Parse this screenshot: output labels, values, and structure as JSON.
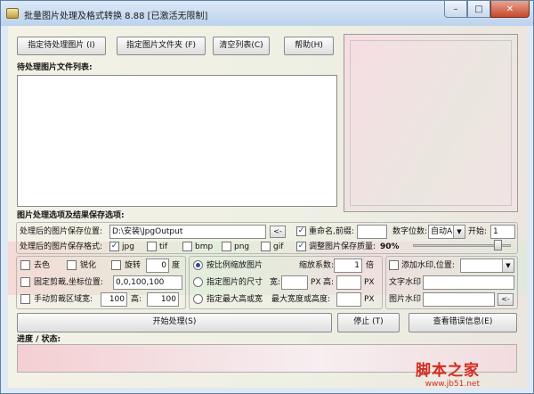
{
  "window": {
    "title": "批量图片处理及格式转换 8.88 [已激活无限制]",
    "min": "–",
    "max": "□",
    "close": "✕"
  },
  "toolbar": {
    "select_images": "指定待处理图片 (I)",
    "select_folder": "指定图片文件夹 (F)",
    "clear_list": "清空列表(C)",
    "help": "帮助(H)"
  },
  "file_list": {
    "label": "待处理图片文件列表:"
  },
  "options": {
    "heading": "图片处理选项及结果保存选项:",
    "save_location_label": "处理后的图片保存位置:",
    "save_location_value": "D:\\安装\\JpgOutput",
    "browse": "<-",
    "save_format_label": "处理后的图片保存格式:",
    "formats": [
      {
        "label": "jpg",
        "checked": "✓"
      },
      {
        "label": "tif",
        "checked": ""
      },
      {
        "label": "bmp",
        "checked": ""
      },
      {
        "label": "png",
        "checked": ""
      },
      {
        "label": "gif",
        "checked": ""
      }
    ],
    "rename_label": "重命名,前缀:",
    "rename_checked": "✓",
    "digits_label": "数字位数:",
    "digits_value": "自动A",
    "start_label": "开始:",
    "start_value": "1",
    "quality_label": "调整图片保存质量:",
    "quality_checked": "✓",
    "quality_value": "90%",
    "quality_level": 0.9
  },
  "adjust": {
    "desaturate": "去色",
    "sharpen": "锐化",
    "rotate": "旋转",
    "rotate_value": "0",
    "rotate_unit": "度",
    "fixed_crop": "固定剪裁,坐标位置:",
    "fixed_crop_value": "0,0,100,100",
    "manual_crop": "手动剪裁区域宽:",
    "crop_width": "100",
    "crop_height_label": "高:",
    "crop_height": "100"
  },
  "scale": {
    "by_ratio": "按比例缩放图片",
    "ratio_label": "缩放系数:",
    "ratio_value": "1",
    "ratio_unit": "倍",
    "by_size": "指定图片的尺寸",
    "width_label": "宽:",
    "px": "PX",
    "height_label": "高:",
    "by_max": "指定最大高或宽",
    "max_label": "最大宽度或高度:"
  },
  "watermark": {
    "add_label": "添加水印,位置:",
    "text_label": "文字水印",
    "image_label": "图片水印",
    "browse": "<-"
  },
  "actions": {
    "start": "开始处理(S)",
    "stop": "停止 (T)",
    "view_errors": "查看错误信息(E)"
  },
  "status": {
    "label": "进度 / 状态:"
  },
  "watermark_logo": {
    "text": "脚本之家",
    "url": "www.jb51.net"
  }
}
